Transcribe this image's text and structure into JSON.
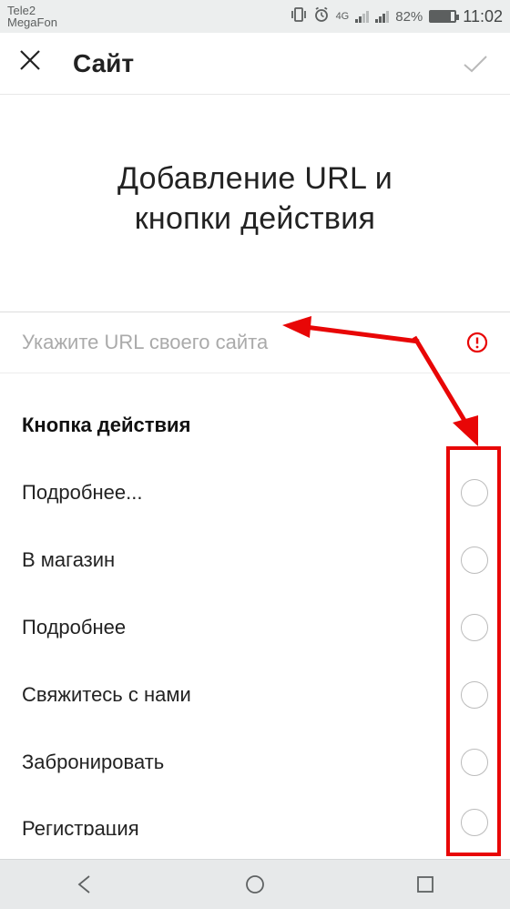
{
  "status": {
    "carrier1": "Tele2",
    "carrier2": "MegaFon",
    "net_label": "4G",
    "battery_pct": "82%",
    "battery_fill": 82,
    "time": "11:02"
  },
  "header": {
    "title": "Сайт"
  },
  "hero": {
    "line1": "Добавление URL и",
    "line2": "кнопки действия"
  },
  "url_input": {
    "placeholder": "Укажите URL своего сайта"
  },
  "section": {
    "title": "Кнопка действия"
  },
  "options": [
    {
      "label": "Подробнее..."
    },
    {
      "label": "В магазин"
    },
    {
      "label": "Подробнее"
    },
    {
      "label": "Свяжитесь с нами"
    },
    {
      "label": "Забронировать"
    },
    {
      "label": "Регистрация"
    }
  ],
  "colors": {
    "accent_red": "#e80606",
    "divider": "#e7e7e7",
    "placeholder": "#aaaaaa"
  }
}
